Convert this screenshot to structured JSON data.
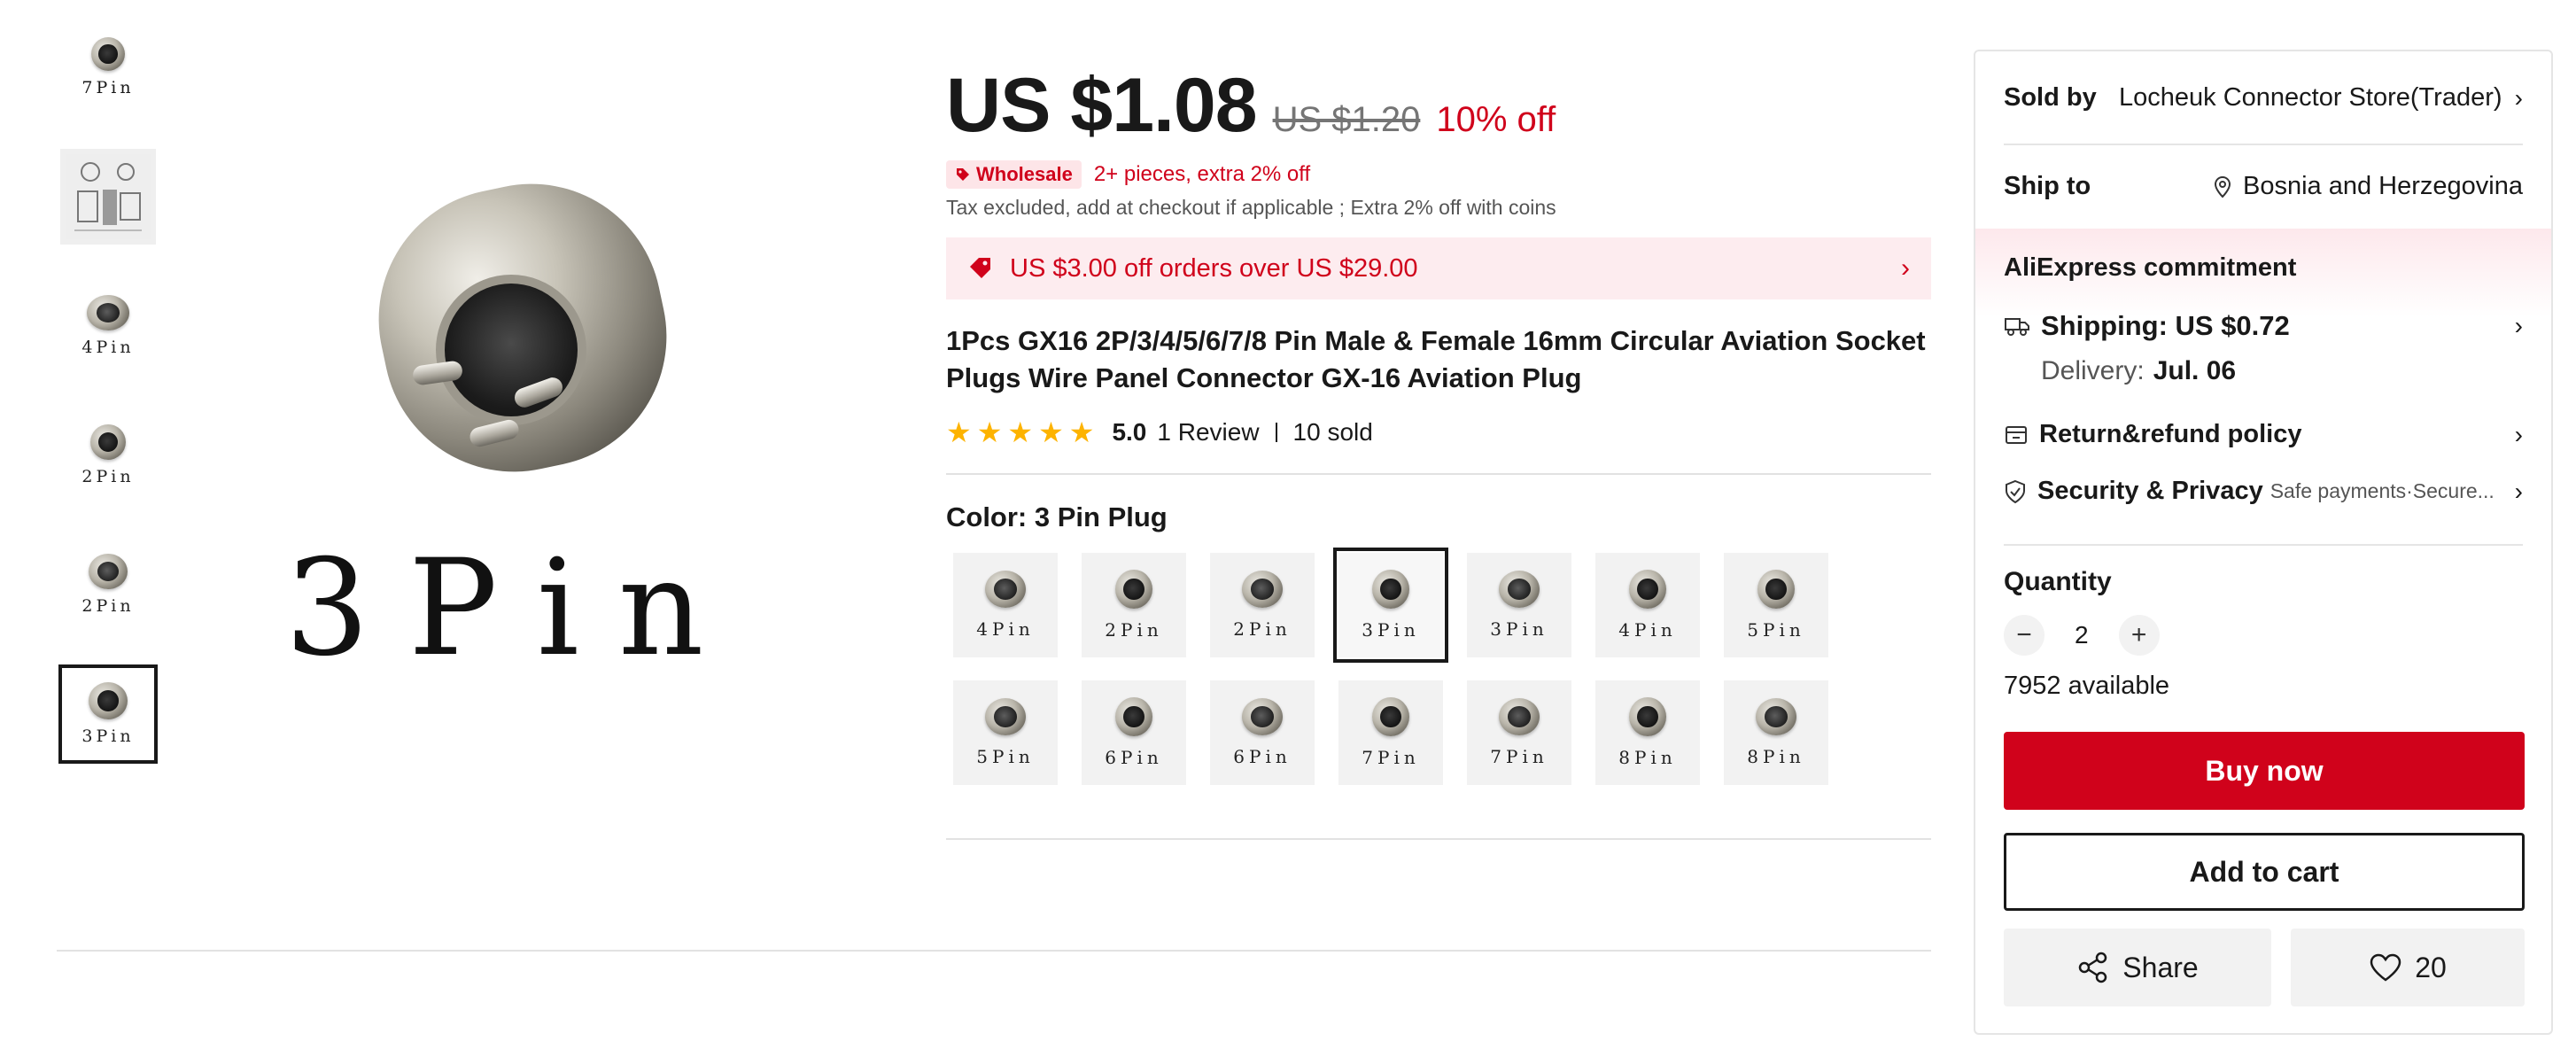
{
  "thumbnails": [
    {
      "caption": "7Pin",
      "type": "connector",
      "partial": true
    },
    {
      "caption": "",
      "type": "diagram"
    },
    {
      "caption": "4Pin",
      "type": "connector"
    },
    {
      "caption": "2Pin",
      "type": "connector"
    },
    {
      "caption": "2Pin",
      "type": "connector"
    },
    {
      "caption": "3Pin",
      "type": "connector",
      "selected": true
    }
  ],
  "main_image": {
    "caption": "3Pin"
  },
  "price": {
    "current": "US $1.08",
    "original": "US $1.20",
    "discount": "10% off"
  },
  "wholesale": {
    "badge": "Wholesale",
    "text": "2+ pieces, extra 2% off"
  },
  "tax_note": "Tax excluded, add at checkout if applicable ; Extra 2% off with coins",
  "coupon": {
    "text": "US $3.00 off orders over US $29.00",
    "icon": "tag-icon"
  },
  "product_title": "1Pcs GX16 2P/3/4/5/6/7/8 Pin Male & Female 16mm Circular Aviation Socket Plugs Wire Panel Connector GX-16 Aviation Plug",
  "rating": {
    "stars": 5,
    "score": "5.0",
    "reviews": "1 Review",
    "sold": "10 sold"
  },
  "color": {
    "label": "Color:",
    "selected": "3 Pin Plug"
  },
  "swatches": [
    {
      "caption": "4Pin",
      "female": true
    },
    {
      "caption": "2Pin",
      "female": false
    },
    {
      "caption": "2Pin",
      "female": true
    },
    {
      "caption": "3Pin",
      "female": false,
      "selected": true
    },
    {
      "caption": "3Pin",
      "female": true
    },
    {
      "caption": "4Pin",
      "female": false
    },
    {
      "caption": "5Pin",
      "female": false
    },
    {
      "caption": "5Pin",
      "female": true
    },
    {
      "caption": "6Pin",
      "female": false
    },
    {
      "caption": "6Pin",
      "female": true
    },
    {
      "caption": "7Pin",
      "female": false
    },
    {
      "caption": "7Pin",
      "female": true
    },
    {
      "caption": "8Pin",
      "female": false
    },
    {
      "caption": "8Pin",
      "female": true
    }
  ],
  "panel": {
    "sold_by_label": "Sold by",
    "store": "Locheuk Connector Store(Trader)",
    "ship_to_label": "Ship to",
    "ship_to": "Bosnia and Herzegovina",
    "commitment": "AliExpress commitment",
    "shipping": "Shipping: US $0.72",
    "delivery_label": "Delivery:",
    "delivery_date": "Jul. 06",
    "refund": "Return&refund policy",
    "security": "Security & Privacy",
    "security_sub": "Safe payments·Secure...",
    "quantity_label": "Quantity",
    "quantity": "2",
    "available": "7952 available",
    "buy_now": "Buy now",
    "add_to_cart": "Add to cart",
    "share": "Share",
    "wishlist_count": "20"
  },
  "colors": {
    "accent": "#d0021b",
    "star": "#fdb300",
    "coupon_bg": "#fdecef"
  }
}
